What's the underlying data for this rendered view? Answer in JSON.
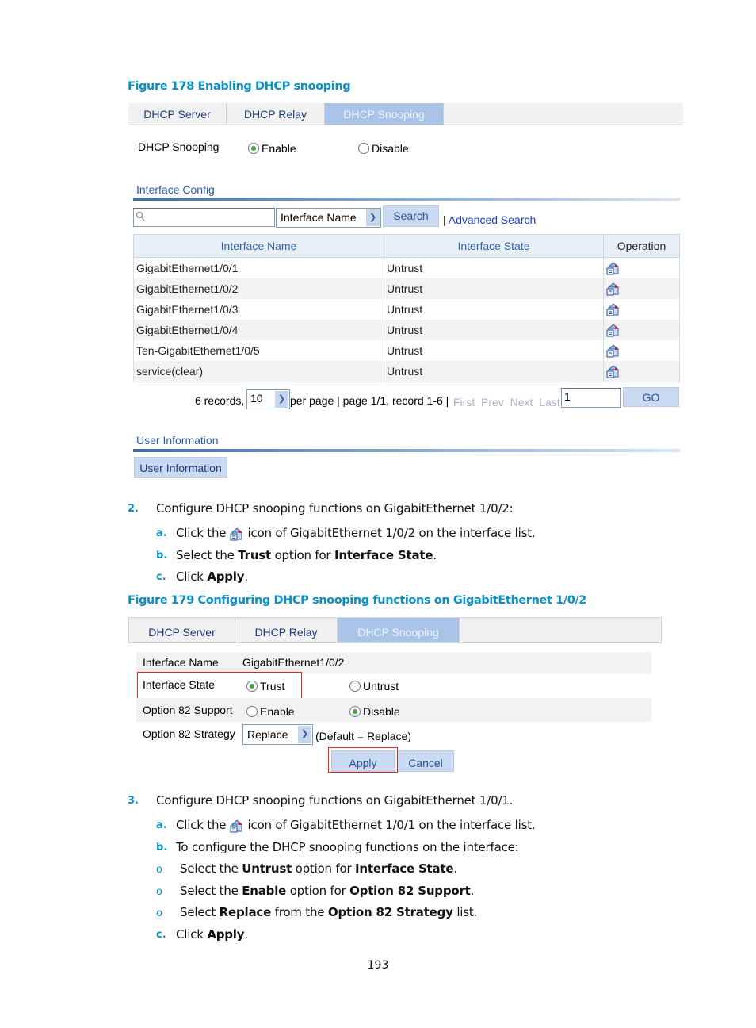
{
  "figure178": {
    "title": "Figure 178 Enabling DHCP snooping",
    "tabs": [
      {
        "label": "DHCP Server",
        "active": false
      },
      {
        "label": "DHCP Relay",
        "active": false
      },
      {
        "label": "DHCP Snooping",
        "active": true
      }
    ],
    "snooping": {
      "label": "DHCP Snooping",
      "enable_label": "Enable",
      "disable_label": "Disable",
      "selected": "Enable"
    },
    "interface_config": {
      "section_label": "Interface Config",
      "search_input_value": "",
      "search_field_select": "Interface Name",
      "search_button": "Search",
      "advanced_search_sep": "|",
      "advanced_search_link": "Advanced Search",
      "columns": [
        "Interface Name",
        "Interface State",
        "Operation"
      ],
      "rows": [
        {
          "name": "GigabitEthernet1/0/1",
          "state": "Untrust",
          "operation_icon": "configure-icon"
        },
        {
          "name": "GigabitEthernet1/0/2",
          "state": "Untrust",
          "operation_icon": "configure-icon"
        },
        {
          "name": "GigabitEthernet1/0/3",
          "state": "Untrust",
          "operation_icon": "configure-icon"
        },
        {
          "name": "GigabitEthernet1/0/4",
          "state": "Untrust",
          "operation_icon": "configure-icon"
        },
        {
          "name": "Ten-GigabitEthernet1/0/5",
          "state": "Untrust",
          "operation_icon": "configure-icon"
        },
        {
          "name": "service(clear)",
          "state": "Untrust",
          "operation_icon": "configure-icon"
        }
      ],
      "pagination": {
        "records_text": "6 records,",
        "per_page_value": "10",
        "per_page_text": "per page | page 1/1, record 1-6 |",
        "first": "First",
        "prev": "Prev",
        "next": "Next",
        "last": "Last",
        "page_input_value": "1",
        "go_button": "GO"
      }
    },
    "user_information": {
      "section_label": "User Information",
      "button_label": "User Information"
    }
  },
  "step2": {
    "number": "2.",
    "text": "Configure DHCP snooping functions on GigabitEthernet 1/0/2:",
    "substeps": [
      {
        "letter": "a.",
        "pre": "Click the",
        "post": "icon of GigabitEthernet 1/0/2 on the interface list."
      },
      {
        "letter": "b.",
        "parts": [
          "Select the ",
          "Trust",
          " option for ",
          "Interface State",
          "."
        ]
      },
      {
        "letter": "c.",
        "parts": [
          "Click ",
          "Apply",
          "."
        ]
      }
    ]
  },
  "figure179": {
    "title": "Figure 179 Configuring DHCP snooping functions on GigabitEthernet 1/0/2",
    "tabs": [
      {
        "label": "DHCP Server",
        "active": false
      },
      {
        "label": "DHCP Relay",
        "active": false
      },
      {
        "label": "DHCP Snooping",
        "active": true
      }
    ],
    "form": {
      "interface_name_label": "Interface Name",
      "interface_name_value": "GigabitEthernet1/0/2",
      "interface_state_label": "Interface State",
      "trust_label": "Trust",
      "untrust_label": "Untrust",
      "interface_state_selected": "Trust",
      "option82_support_label": "Option 82 Support",
      "enable_label": "Enable",
      "disable_label": "Disable",
      "option82_support_selected": "Disable",
      "option82_strategy_label": "Option 82 Strategy",
      "option82_strategy_value": "Replace",
      "option82_strategy_hint": "(Default = Replace)",
      "apply_button": "Apply",
      "cancel_button": "Cancel"
    }
  },
  "step3": {
    "number": "3.",
    "text": "Configure DHCP snooping functions on GigabitEthernet 1/0/1.",
    "substeps": [
      {
        "letter": "a.",
        "pre": "Click the",
        "post": "icon of GigabitEthernet 1/0/1 on the interface list."
      },
      {
        "letter": "b.",
        "text": "To configure the DHCP snooping functions on the interface:"
      },
      {
        "letter": "c.",
        "parts": [
          "Click ",
          "Apply",
          "."
        ]
      }
    ],
    "bullets": [
      {
        "marker": "o",
        "parts": [
          "Select the ",
          "Untrust",
          " option for ",
          "Interface State",
          "."
        ]
      },
      {
        "marker": "o",
        "parts": [
          "Select the ",
          "Enable",
          " option for ",
          "Option 82 Support",
          "."
        ]
      },
      {
        "marker": "o",
        "parts": [
          "Select ",
          "Replace",
          " from the ",
          "Option 82 Strategy",
          " list."
        ]
      }
    ]
  },
  "page_number": "193"
}
